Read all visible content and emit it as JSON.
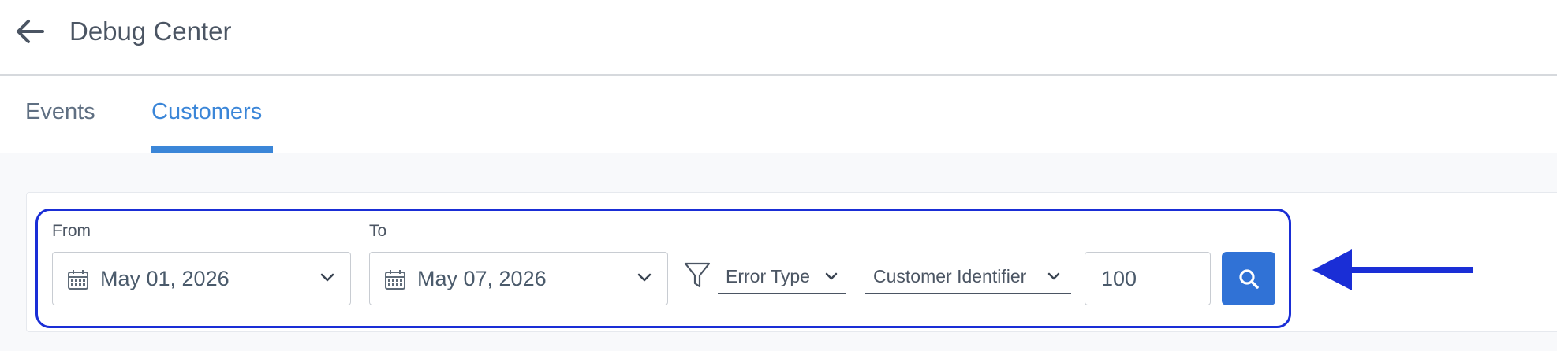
{
  "header": {
    "back_icon": "arrow-left-icon",
    "title": "Debug Center"
  },
  "tabs": [
    {
      "label": "Events",
      "active": false
    },
    {
      "label": "Customers",
      "active": true
    }
  ],
  "filters": {
    "from": {
      "label": "From",
      "value": "May 01, 2026"
    },
    "to": {
      "label": "To",
      "value": "May 07, 2026"
    },
    "error_type": {
      "label": "Error Type"
    },
    "customer_identifier": {
      "label": "Customer Identifier"
    },
    "limit": {
      "value": "100"
    },
    "search_icon": "search-icon"
  },
  "colors": {
    "accent": "#3b86d8",
    "button": "#3072d6",
    "annotation": "#1a2ed6"
  }
}
